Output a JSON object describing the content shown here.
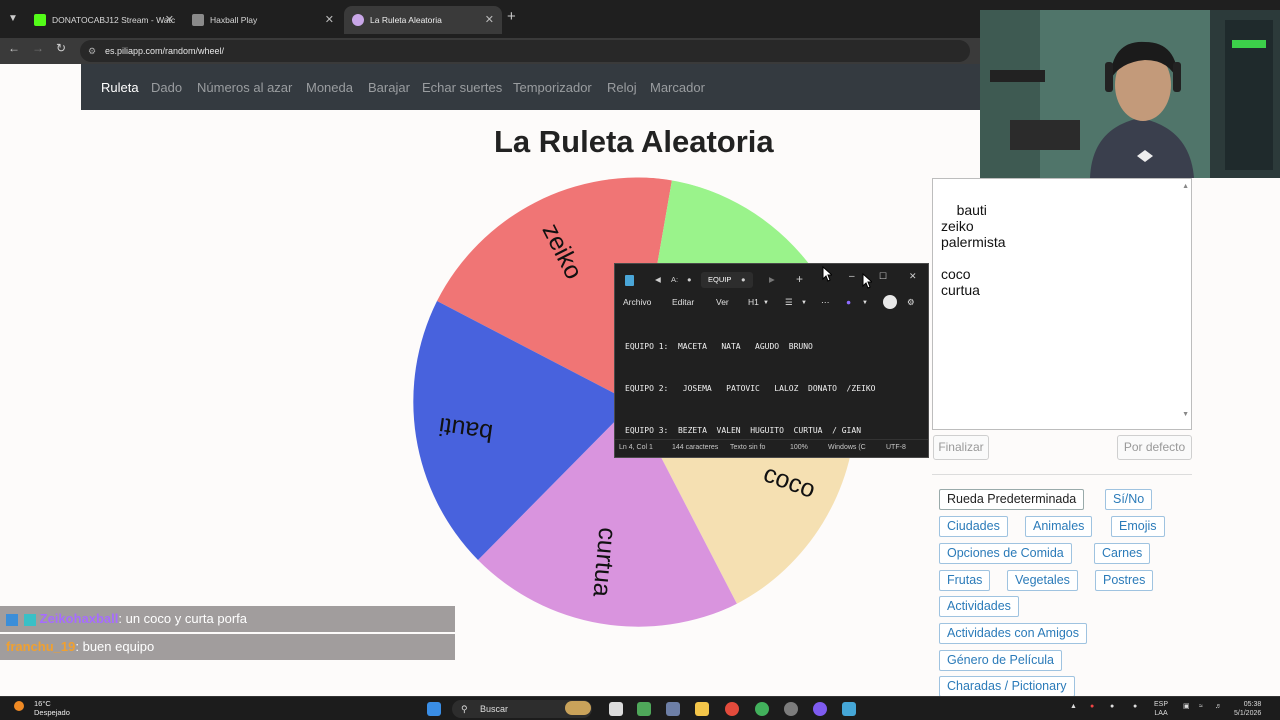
{
  "browser": {
    "tabs": [
      {
        "label": "DONATOCABJ12 Stream - Watc"
      },
      {
        "label": "Haxball Play"
      },
      {
        "label": "La Ruleta Aleatoria"
      }
    ],
    "url": "es.piliapp.com/random/wheel/"
  },
  "nav": {
    "items": [
      "Ruleta",
      "Dado",
      "Números al azar",
      "Moneda",
      "Barajar",
      "Echar suertes",
      "Temporizador",
      "Reloj",
      "Marcador"
    ]
  },
  "page": {
    "title": "La Ruleta Aleatoria"
  },
  "wheel": {
    "segments": [
      {
        "name": "zeiko",
        "color": "#f07575"
      },
      {
        "name": "palermista",
        "color": "#9af38b"
      },
      {
        "name": "coco",
        "color": "#f5e0b2"
      },
      {
        "name": "curtua",
        "color": "#d994de"
      },
      {
        "name": "bauti",
        "color": "#4862dd"
      }
    ],
    "visible_labels": {
      "zeiko": "zeiko",
      "bauti": "bauti",
      "curtua": "curtua",
      "coco": "coco"
    }
  },
  "names_box": {
    "text": "bauti\nzeiko\npalermista\n\ncoco\ncurtua"
  },
  "buttons": {
    "finalizar": "Finalizar",
    "defecto": "Por defecto"
  },
  "presets": [
    "Rueda Predeterminada",
    "Sí/No",
    "Ciudades",
    "Animales",
    "Emojis",
    "Opciones de Comida",
    "Carnes",
    "Frutas",
    "Vegetales",
    "Postres",
    "Actividades",
    "Actividades con Amigos",
    "Género de Película",
    "Charadas / Pictionary"
  ],
  "notepad": {
    "tab_prefix": "A:",
    "tab_label": "EQUIP",
    "menu": [
      "Archivo",
      "Editar",
      "Ver",
      "H1"
    ],
    "lines": [
      "EQUIPO 1:  MACETA   NATA   AGUDO  BRUNO",
      "EQUIPO 2:   JOSEMA   PATOVIC   LALOZ  DONATO  /ZEIKO",
      "EQUIPO 3:  BEZETA  VALEN  HUGUITO  CURTUA  / GIAN"
    ],
    "status": [
      "Ln 4, Col 1",
      "144 caracteres",
      "Texto sin fo",
      "100%",
      "Windows (C",
      "UTF-8"
    ]
  },
  "chat": [
    {
      "user": "Zeikohaxball",
      "message": ": un coco y curta porfa",
      "user_color": "#a66cff"
    },
    {
      "user": "franchu_19",
      "message": ": buen equipo",
      "user_color": "#f0a030"
    }
  ],
  "taskbar": {
    "temp": "16°C",
    "weather": "Despejado",
    "search": "Buscar",
    "lang": "ESP",
    "lang2": "LAA",
    "time": "05:38",
    "date": "5/1/2026"
  }
}
